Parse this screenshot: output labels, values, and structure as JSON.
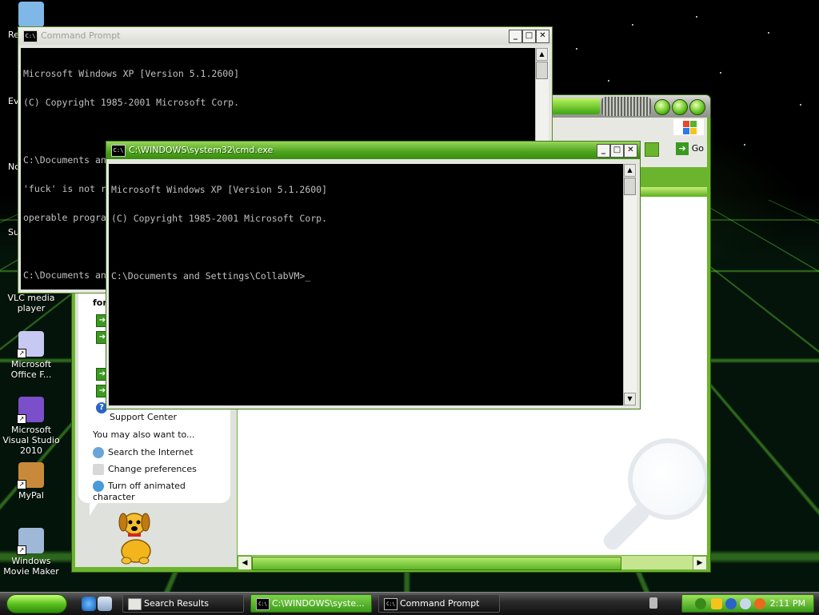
{
  "desktop_icons": [
    {
      "id": "recycle",
      "label": "Re",
      "icon": "recycle-bin-icon",
      "color": "#7fb7e6"
    },
    {
      "id": "vlc",
      "label": "VLC media player",
      "icon": "vlc-icon",
      "color": "#f08a1c"
    },
    {
      "id": "office",
      "label": "Microsoft Office F...",
      "icon": "office-icon",
      "color": "#c7c9f2"
    },
    {
      "id": "vs",
      "label": "Microsoft Visual Studio 2010",
      "icon": "visual-studio-icon",
      "color": "#7a4fc9"
    },
    {
      "id": "mypal",
      "label": "MyPal",
      "icon": "mypal-icon",
      "color": "#c88a3a"
    },
    {
      "id": "moviemaker",
      "label": "Windows Movie Maker",
      "icon": "movie-maker-icon",
      "color": "#9fb8d8"
    }
  ],
  "desktop_partial_labels": [
    "Ev",
    "No",
    "Su"
  ],
  "explorer": {
    "go_label": "Go",
    "left_pane": {
      "question_fragment": "for?",
      "support_center": "Support Center",
      "also_heading": "You may also want to...",
      "links": [
        {
          "label": "Search the Internet",
          "icon": "search-internet-icon",
          "color": "#6aa4d8"
        },
        {
          "label": "Change preferences",
          "icon": "preferences-icon",
          "color": "#d8d8d8"
        },
        {
          "label": "Turn off animated character",
          "icon": "animated-character-icon",
          "color": "#4a9ad8"
        }
      ]
    }
  },
  "cmd_back": {
    "title": "Command Prompt",
    "lines": [
      "Microsoft Windows XP [Version 5.1.2600]",
      "(C) Copyright 1985-2001 Microsoft Corp.",
      "",
      "C:\\Documents and Settings\\CollabVM>fuck ur mom",
      "'fuck' is not recognized as an internal or external command,",
      "operable program or batch file.",
      "",
      "C:\\Documents and Settings\\CollabVM>"
    ]
  },
  "cmd_front": {
    "title": "C:\\WINDOWS\\system32\\cmd.exe",
    "lines": [
      "Microsoft Windows XP [Version 5.1.2600]",
      "(C) Copyright 1985-2001 Microsoft Corp.",
      "",
      "C:\\Documents and Settings\\CollabVM>_"
    ]
  },
  "window_buttons": {
    "minimize": "_",
    "maximize": "□",
    "close": "✕"
  },
  "taskbar": {
    "tasks": [
      {
        "label": "Search Results",
        "active": false
      },
      {
        "label": "C:\\WINDOWS\\syste...",
        "active": true
      },
      {
        "label": "Command Prompt",
        "active": false
      }
    ],
    "clock": "2:11 PM"
  }
}
